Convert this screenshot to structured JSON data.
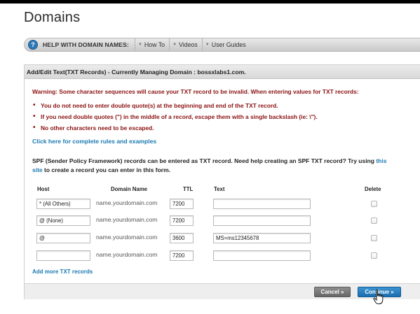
{
  "page": {
    "title": "Domains"
  },
  "help_bar": {
    "label": "HELP WITH DOMAIN NAMES:",
    "links": [
      "How To",
      "Videos",
      "User Guides"
    ]
  },
  "panel": {
    "header": "Add/Edit Text(TXT Records) - Currently Managing Domain : bossxlabs1.com.",
    "warning": "Warning: Some character sequences will cause your TXT record to be invalid. When entering values for TXT records:",
    "bullets": [
      "You do not need to enter double quote(s) at the beginning and end of the TXT record.",
      "If you need double quotes (\") in the middle of a record, escape them with a single backslash (ie: \\\").",
      "No other characters need to be escaped."
    ],
    "rules_link": "Click here for complete rules and examples",
    "spf_text_1": "SPF (Sender Policy Framework) records can be entered as TXT record. Need help creating an SPF TXT record? Try using ",
    "spf_link_1": "this",
    "spf_link_2": "site",
    "spf_text_2": " to create a record you can enter in this form."
  },
  "table": {
    "columns": [
      "Host",
      "Domain Name",
      "TTL",
      "Text",
      "Delete"
    ],
    "rows": [
      {
        "host": "* (All Others)",
        "domain": "name.yourdomain.com",
        "ttl": "7200",
        "text": ""
      },
      {
        "host": "@ (None)",
        "domain": "name.yourdomain.com",
        "ttl": "7200",
        "text": ""
      },
      {
        "host": "@",
        "domain": "name.yourdomain.com",
        "ttl": "3600",
        "text": "MS=ms12345678"
      },
      {
        "host": "",
        "domain": "name.yourdomain.com",
        "ttl": "7200",
        "text": ""
      }
    ],
    "add_more": "Add more TXT records"
  },
  "buttons": {
    "cancel": "Cancel »",
    "continue": "Continue »"
  },
  "colors": {
    "warning": "#8b1111",
    "link": "#1a7ab3",
    "continue_button": "#1b6eaf",
    "cancel_button": "#676767"
  }
}
